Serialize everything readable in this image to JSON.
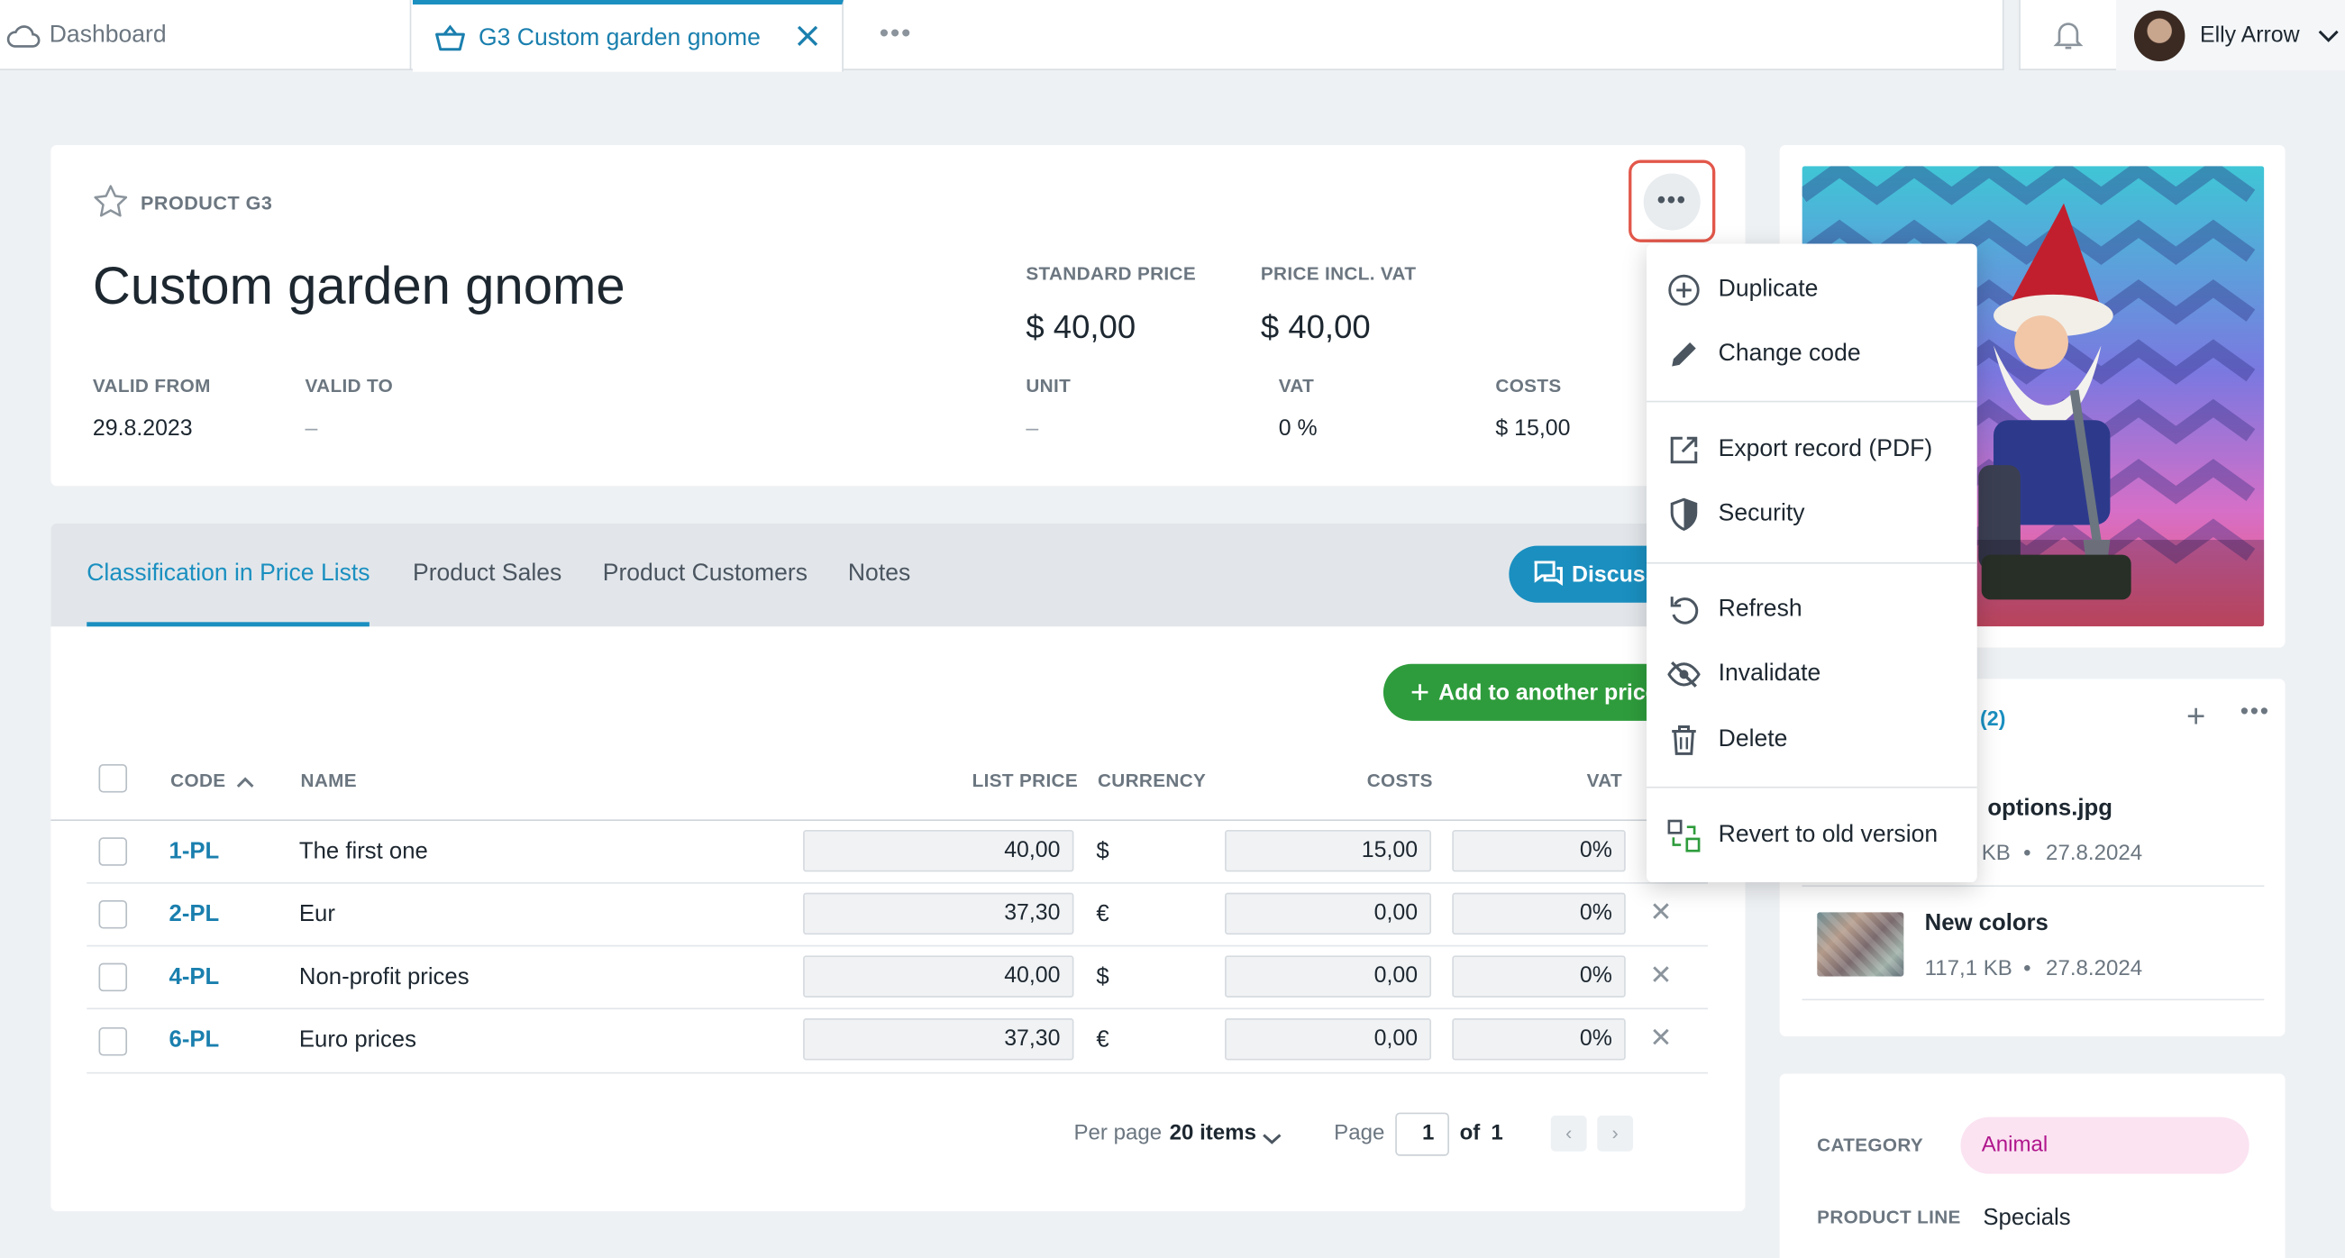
{
  "tabs_top": {
    "dashboard": "Dashboard",
    "active": "G3 Custom garden gnome",
    "more": "•••"
  },
  "user": {
    "name": "Elly Arrow"
  },
  "product": {
    "code_label": "PRODUCT G3",
    "title": "Custom garden gnome",
    "valid_from_label": "VALID FROM",
    "valid_from": "29.8.2023",
    "valid_to_label": "VALID TO",
    "valid_to": "–",
    "standard_price_label": "STANDARD PRICE",
    "standard_price": "$ 40,00",
    "price_incl_vat_label": "PRICE INCL. VAT",
    "price_incl_vat": "$ 40,00",
    "unit_label": "UNIT",
    "unit": "–",
    "vat_label": "VAT",
    "vat": "0 %",
    "costs_label": "COSTS",
    "costs": "$ 15,00"
  },
  "section_tabs": [
    "Classification in Price Lists",
    "Product Sales",
    "Product Customers",
    "Notes"
  ],
  "buttons": {
    "discuss": "Discuss",
    "add_price_list": "Add to another price list"
  },
  "table": {
    "headers": {
      "code": "CODE",
      "name": "NAME",
      "list_price": "LIST PRICE",
      "currency": "CURRENCY",
      "costs": "COSTS",
      "vat": "VAT"
    },
    "rows": [
      {
        "code": "1-PL",
        "name": "The first one",
        "list_price": "40,00",
        "currency": "$",
        "costs": "15,00",
        "vat": "0%"
      },
      {
        "code": "2-PL",
        "name": "Eur",
        "list_price": "37,30",
        "currency": "€",
        "costs": "0,00",
        "vat": "0%"
      },
      {
        "code": "4-PL",
        "name": "Non-profit prices",
        "list_price": "40,00",
        "currency": "$",
        "costs": "0,00",
        "vat": "0%"
      },
      {
        "code": "6-PL",
        "name": "Euro prices",
        "list_price": "37,30",
        "currency": "€",
        "costs": "0,00",
        "vat": "0%"
      }
    ]
  },
  "pager": {
    "per_page_label": "Per page",
    "per_page_value": "20 items",
    "page_label": "Page",
    "page_value": "1",
    "of_label": "of",
    "total_pages": "1"
  },
  "attachments": {
    "count": "(2)",
    "files": [
      {
        "name": "options.jpg",
        "size": "KB",
        "date": "27.8.2024"
      },
      {
        "name": "New colors",
        "size": "117,1 KB",
        "date": "27.8.2024"
      }
    ]
  },
  "info": {
    "category_label": "CATEGORY",
    "category_value": "Animal",
    "product_line_label": "PRODUCT LINE",
    "product_line_value": "Specials"
  },
  "menu": {
    "items": [
      "Duplicate",
      "Change code",
      "Export record (PDF)",
      "Security",
      "Refresh",
      "Invalidate",
      "Delete",
      "Revert to old version"
    ]
  },
  "colors": {
    "accent": "#1a8fc0",
    "success": "#2e9c3c",
    "danger_outline": "#e2574a",
    "category_pill": "#fbe3f2"
  }
}
